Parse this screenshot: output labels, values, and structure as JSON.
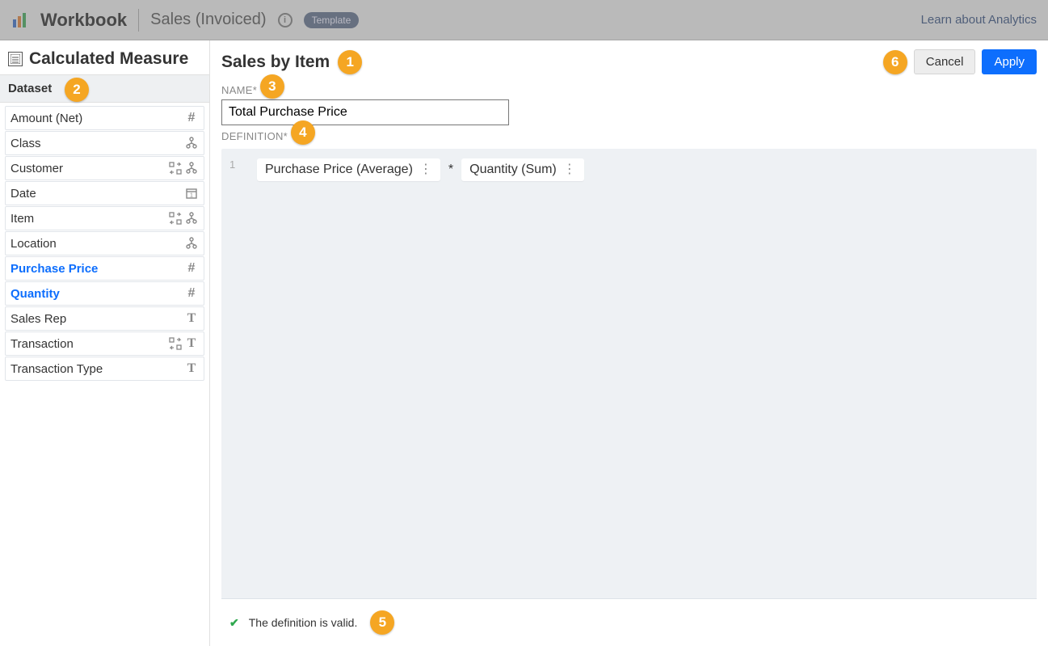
{
  "header": {
    "app_label": "Workbook",
    "workbook_name": "Sales (Invoiced)",
    "template_badge": "Template",
    "learn_link": "Learn about Analytics"
  },
  "left": {
    "title": "Calculated Measure",
    "dataset_label": "Dataset",
    "fields": [
      {
        "name": "Amount (Net)",
        "icons": [
          "hash"
        ],
        "active": false
      },
      {
        "name": "Class",
        "icons": [
          "hier"
        ],
        "active": false
      },
      {
        "name": "Customer",
        "icons": [
          "swap",
          "hier"
        ],
        "active": false
      },
      {
        "name": "Date",
        "icons": [
          "cal"
        ],
        "active": false
      },
      {
        "name": "Item",
        "icons": [
          "swap",
          "hier"
        ],
        "active": false
      },
      {
        "name": "Location",
        "icons": [
          "hier"
        ],
        "active": false
      },
      {
        "name": "Purchase Price",
        "icons": [
          "hash"
        ],
        "active": true
      },
      {
        "name": "Quantity",
        "icons": [
          "hash"
        ],
        "active": true
      },
      {
        "name": "Sales Rep",
        "icons": [
          "text"
        ],
        "active": false
      },
      {
        "name": "Transaction",
        "icons": [
          "swap",
          "text"
        ],
        "active": false
      },
      {
        "name": "Transaction Type",
        "icons": [
          "text"
        ],
        "active": false
      }
    ]
  },
  "right": {
    "title": "Sales by Item",
    "cancel_label": "Cancel",
    "apply_label": "Apply",
    "name_label": "NAME*",
    "name_value": "Total Purchase Price",
    "definition_label": "DEFINITION*",
    "line_number": "1",
    "tokens": [
      {
        "text": "Purchase Price (Average)"
      },
      {
        "op": "*"
      },
      {
        "text": "Quantity (Sum)"
      }
    ],
    "validation_message": "The definition is valid."
  },
  "callouts": {
    "c1": "1",
    "c2": "2",
    "c3": "3",
    "c4": "4",
    "c5": "5",
    "c6": "6"
  }
}
